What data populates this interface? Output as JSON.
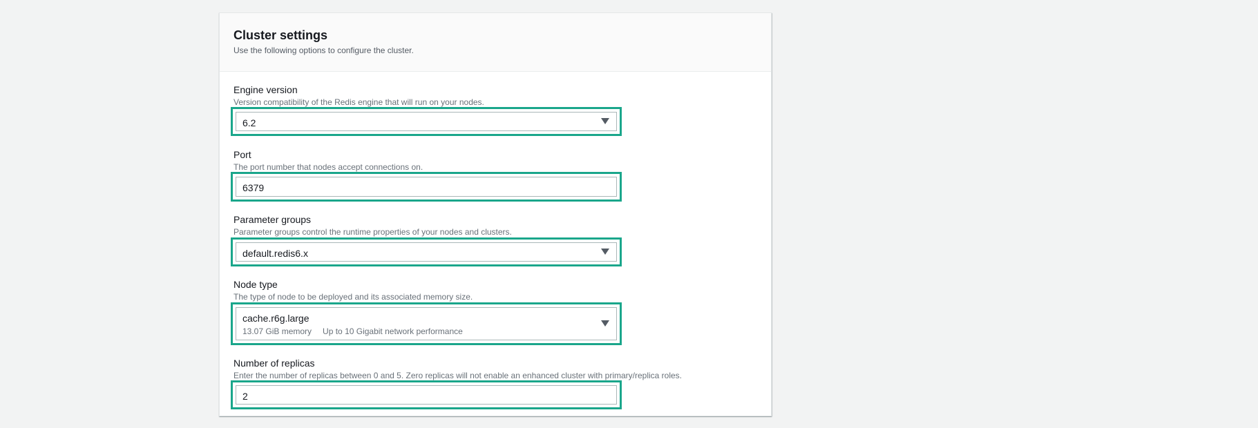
{
  "section": {
    "title": "Cluster settings",
    "description": "Use the following options to configure the cluster."
  },
  "engine_version": {
    "label": "Engine version",
    "description": "Version compatibility of the Redis engine that will run on your nodes.",
    "value": "6.2",
    "icon": "caret-down-icon"
  },
  "port": {
    "label": "Port",
    "description": "The port number that nodes accept connections on.",
    "value": "6379"
  },
  "parameter_groups": {
    "label": "Parameter groups",
    "description": "Parameter groups control the runtime properties of your nodes and clusters.",
    "value": "default.redis6.x",
    "icon": "caret-down-icon"
  },
  "node_type": {
    "label": "Node type",
    "description": "The type of node to be deployed and its associated memory size.",
    "value": "cache.r6g.large",
    "memory": "13.07 GiB memory",
    "network": "Up to 10 Gigabit network performance",
    "icon": "caret-down-icon"
  },
  "replicas": {
    "label": "Number of replicas",
    "description": "Enter the number of replicas between 0 and 5. Zero replicas will not enable an enhanced cluster with primary/replica roles.",
    "value": "2"
  },
  "colors": {
    "highlight": "#1aa68b",
    "background": "#f2f3f3",
    "panel": "#ffffff"
  }
}
